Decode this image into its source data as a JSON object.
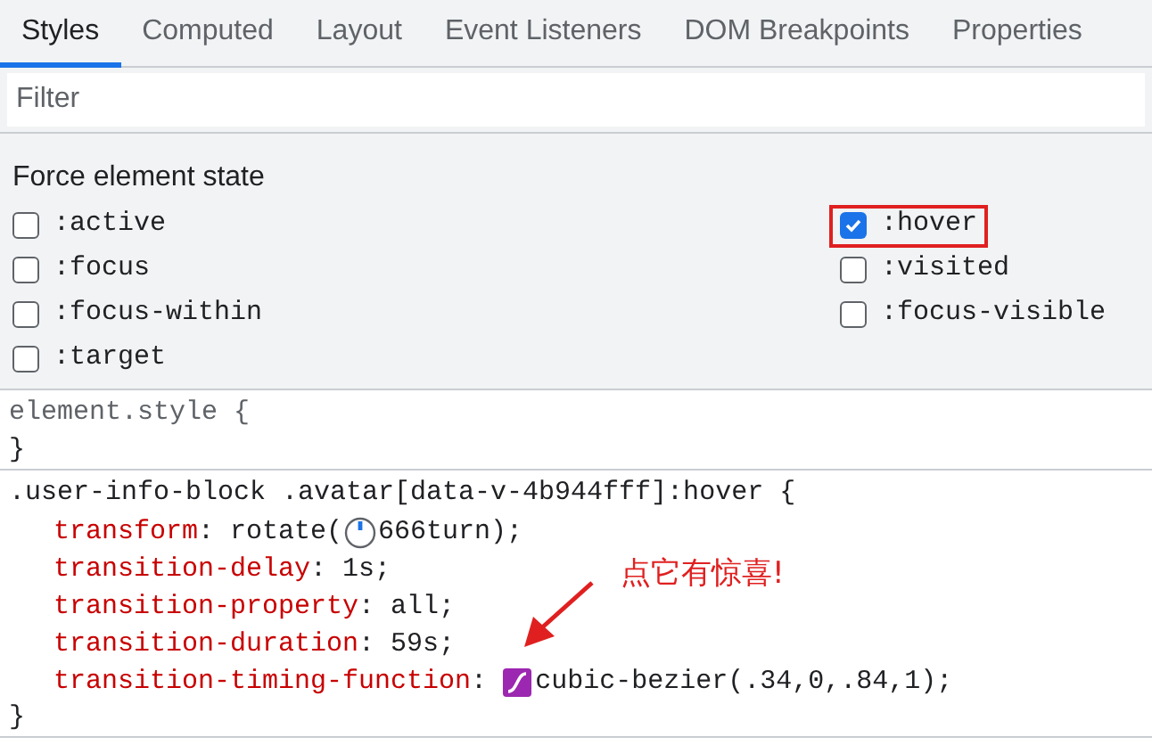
{
  "tabs": [
    {
      "label": "Styles",
      "selected": true
    },
    {
      "label": "Computed",
      "selected": false
    },
    {
      "label": "Layout",
      "selected": false
    },
    {
      "label": "Event Listeners",
      "selected": false
    },
    {
      "label": "DOM Breakpoints",
      "selected": false
    },
    {
      "label": "Properties",
      "selected": false
    }
  ],
  "filter": {
    "placeholder": "Filter"
  },
  "force_state": {
    "title": "Force element state",
    "left": [
      {
        "label": ":active",
        "checked": false,
        "highlighted": false
      },
      {
        "label": ":focus",
        "checked": false,
        "highlighted": false
      },
      {
        "label": ":focus-within",
        "checked": false,
        "highlighted": false
      },
      {
        "label": ":target",
        "checked": false,
        "highlighted": false
      }
    ],
    "right": [
      {
        "label": ":hover",
        "checked": true,
        "highlighted": true
      },
      {
        "label": ":visited",
        "checked": false,
        "highlighted": false
      },
      {
        "label": ":focus-visible",
        "checked": false,
        "highlighted": false
      }
    ]
  },
  "rules": [
    {
      "selector": "element.style {",
      "muted": true,
      "close": "}"
    },
    {
      "selector": ".user-info-block .avatar[data-v-4b944fff]:hover {",
      "muted": false,
      "close": "}",
      "declarations": [
        {
          "property": "transform",
          "value_before": ": rotate(",
          "kind": "angle",
          "value": "666turn);"
        },
        {
          "property": "transition-delay",
          "kind": "plain",
          "value": ": 1s;"
        },
        {
          "property": "transition-property",
          "kind": "plain",
          "value": ": all;"
        },
        {
          "property": "transition-duration",
          "kind": "plain",
          "value": ": 59s;"
        },
        {
          "property": "transition-timing-function",
          "value_before": ": ",
          "kind": "bezier",
          "value": "cubic-bezier(.34,0,.84,1);"
        }
      ]
    }
  ],
  "annotation": {
    "text": "点它有惊喜!"
  }
}
